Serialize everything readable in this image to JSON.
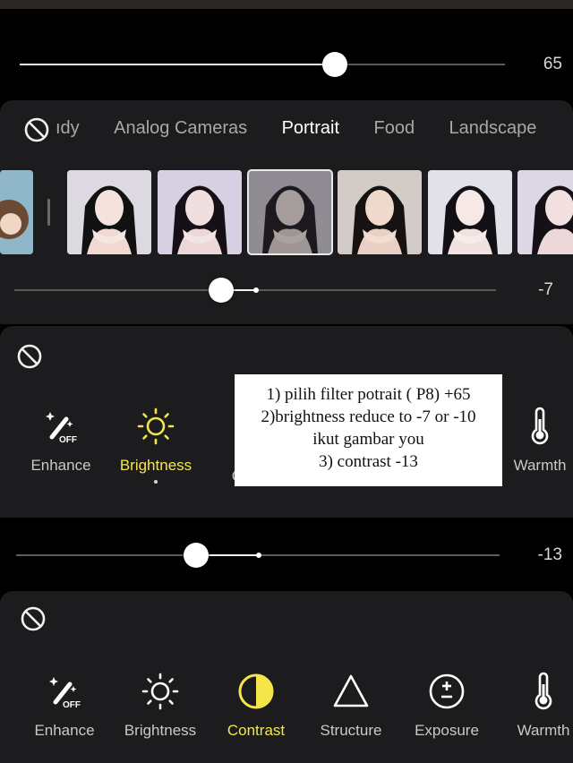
{
  "filter_slider": {
    "value": 65,
    "label": "65"
  },
  "categories": {
    "tabs": [
      {
        "label": "ıdy"
      },
      {
        "label": "Analog Cameras"
      },
      {
        "label": "Portrait"
      },
      {
        "label": "Food"
      },
      {
        "label": "Landscape"
      }
    ],
    "active": "Portrait"
  },
  "filter_thumbnails": {
    "count": 6,
    "selected_index": 2
  },
  "brightness_slider": {
    "value": -7,
    "label": "-7"
  },
  "tools_panel_1": {
    "items": [
      {
        "label": "Enhance",
        "icon": "magic-wand-off-icon"
      },
      {
        "label": "Brightness",
        "icon": "sun-icon",
        "active": true
      },
      {
        "label": "C",
        "icon": "contrast-icon"
      },
      {
        "label": "Warmth",
        "icon": "thermometer-icon"
      }
    ]
  },
  "note": {
    "lines": [
      "1) pilih filter potrait ( P8) +65",
      "2)brightness reduce to -7 or -10",
      "ikut gambar you",
      "3) contrast -13"
    ]
  },
  "contrast_slider": {
    "value": -13,
    "label": "-13"
  },
  "tools_panel_2": {
    "items": [
      {
        "label": "Enhance",
        "icon": "magic-wand-off-icon"
      },
      {
        "label": "Brightness",
        "icon": "sun-icon"
      },
      {
        "label": "Contrast",
        "icon": "contrast-icon",
        "active": true
      },
      {
        "label": "Structure",
        "icon": "triangle-icon"
      },
      {
        "label": "Exposure",
        "icon": "exposure-icon"
      },
      {
        "label": "Warmth",
        "icon": "thermometer-icon"
      }
    ]
  },
  "colors": {
    "accent": "#f5e54a",
    "panel": "#1c1c1e",
    "background": "#000000"
  }
}
